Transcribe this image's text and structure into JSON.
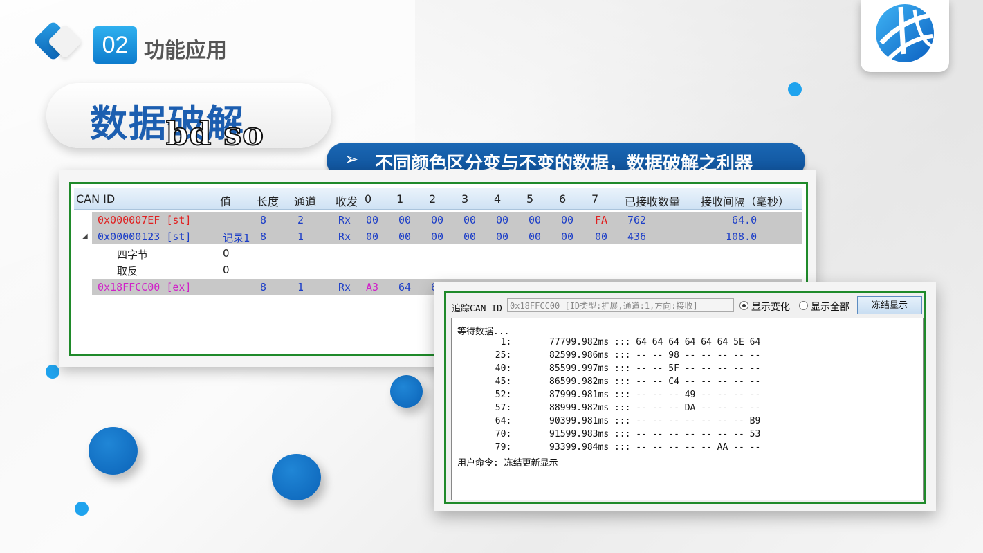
{
  "header": {
    "section_number": "02",
    "section_title": "功能应用"
  },
  "title": {
    "main": "数据破解",
    "watermark": "bd so"
  },
  "banner": {
    "arrow": "➢",
    "text": "不同颜色区分变与不变的数据，数据破解之利器"
  },
  "table": {
    "columns": [
      "CAN ID",
      "值",
      "长度",
      "通道",
      "收发",
      "0",
      "1",
      "2",
      "3",
      "4",
      "5",
      "6",
      "7",
      "已接收数量",
      "接收间隔（毫秒）"
    ],
    "rows": [
      {
        "id": "0x000007EF [st]",
        "value": "",
        "len": "8",
        "ch": "2",
        "dir": "Rx",
        "b0": "00",
        "b1": "00",
        "b2": "00",
        "b3": "00",
        "b4": "00",
        "b5": "00",
        "b6": "00",
        "b7": "FA",
        "count": "762",
        "interval": "64.0"
      },
      {
        "id": "0x00000123 [st]",
        "value": "记录1",
        "len": "8",
        "ch": "1",
        "dir": "Rx",
        "b0": "00",
        "b1": "00",
        "b2": "00",
        "b3": "00",
        "b4": "00",
        "b5": "00",
        "b6": "00",
        "b7": "00",
        "count": "436",
        "interval": "108.0"
      },
      {
        "id": "0x18FFCC00 [ex]",
        "len": "8",
        "ch": "1",
        "dir": "Rx",
        "b0": "A3",
        "b1": "64",
        "b2": "6"
      }
    ],
    "subrows": [
      {
        "name": "四字节",
        "value": "0"
      },
      {
        "name": "取反",
        "value": "0"
      }
    ]
  },
  "trace": {
    "label": "追踪CAN ID",
    "input_value": "0x18FFCC00 [ID类型:扩展,通道:1,方向:接收]",
    "radio_changes": "显示变化",
    "radio_all": "显示全部",
    "freeze_button": "冻结显示",
    "waiting": "等待数据...",
    "lines": [
      "        1:       77799.982ms ::: 64 64 64 64 64 64 5E 64",
      "       25:       82599.986ms ::: -- -- 98 -- -- -- -- --",
      "       40:       85599.997ms ::: -- -- 5F -- -- -- -- --",
      "       45:       86599.982ms ::: -- -- C4 -- -- -- -- --",
      "       52:       87999.981ms ::: -- -- -- 49 -- -- -- --",
      "       57:       88999.982ms ::: -- -- -- DA -- -- -- --",
      "       64:       90399.981ms ::: -- -- -- -- -- -- -- B9",
      "       70:       91599.983ms ::: -- -- -- -- -- -- -- 53",
      "       79:       93399.984ms ::: -- -- -- -- -- AA -- --"
    ],
    "command": "用户命令: 冻结更新显示"
  }
}
